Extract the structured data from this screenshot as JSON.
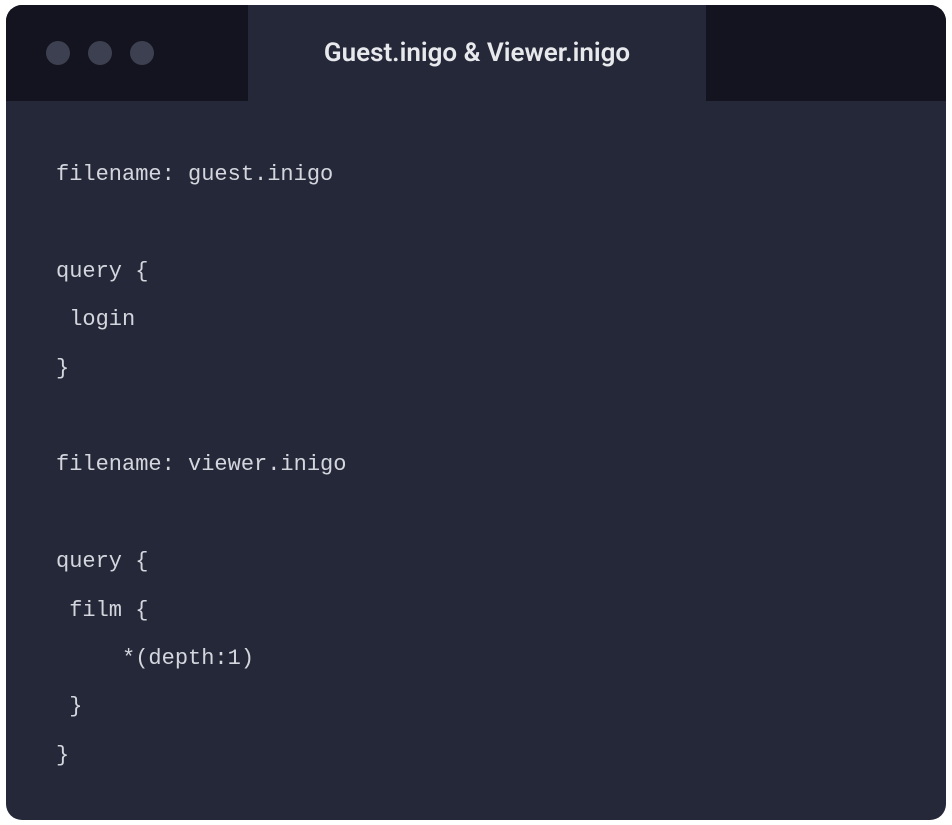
{
  "window": {
    "tab_title": "Guest.inigo & Viewer.inigo"
  },
  "code": {
    "lines": [
      "filename: guest.inigo",
      "",
      "query {",
      " login",
      "}",
      "",
      "filename: viewer.inigo",
      "",
      "query {",
      " film {",
      "     *(depth:1)",
      " }",
      "}"
    ]
  }
}
